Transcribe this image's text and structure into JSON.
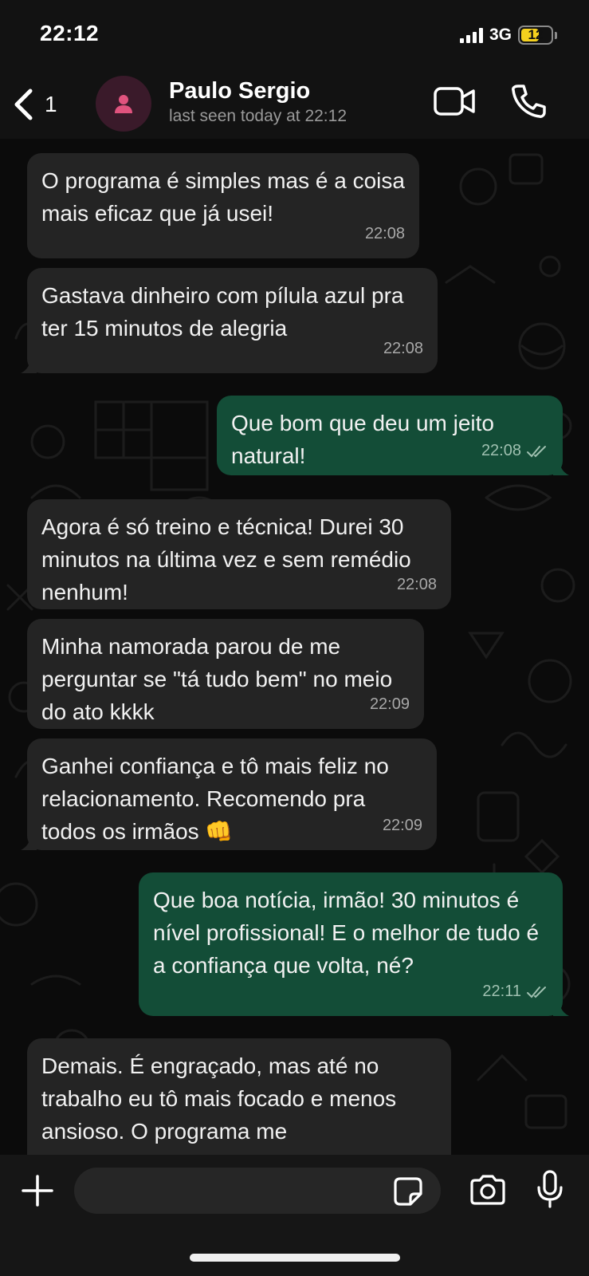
{
  "status_bar": {
    "time": "22:12",
    "network": "3G",
    "battery": "12",
    "battery_level": 0.12
  },
  "header": {
    "back_count": "1",
    "contact_name": "Paulo Sergio",
    "contact_status": "last seen today at 22:12"
  },
  "messages": [
    {
      "direction": "in",
      "text": "O programa é simples mas é a coisa mais eficaz que já usei!",
      "time": "22:08"
    },
    {
      "direction": "in",
      "text": "Gastava dinheiro com pílula azul pra ter 15 minutos de alegria",
      "time": "22:08"
    },
    {
      "direction": "out",
      "text": "Que bom que deu um jeito natural!",
      "time": "22:08",
      "status": "read"
    },
    {
      "direction": "in",
      "text": "Agora é só treino e técnica! Durei 30 minutos na última vez e sem remédio nenhum!",
      "time": "22:08"
    },
    {
      "direction": "in",
      "text": "Minha namorada parou de me perguntar se \"tá tudo bem\" no meio do ato kkkk",
      "time": "22:09"
    },
    {
      "direction": "in",
      "text": "Ganhei confiança e tô mais feliz no relacionamento. Recomendo pra todos os irmãos 👊",
      "time": "22:09"
    },
    {
      "direction": "out",
      "text": "Que boa notícia, irmão! 30 minutos é nível profissional! E o melhor de tudo é a confiança que volta, né?",
      "time": "22:11",
      "status": "read"
    },
    {
      "direction": "in",
      "text": "Demais. É engraçado, mas até no trabalho eu tô mais focado e menos ansioso. O programa me",
      "time": ""
    }
  ],
  "input": {
    "value": "",
    "placeholder": ""
  },
  "colors": {
    "incoming_bubble": "#242424",
    "outgoing_bubble": "#134d37",
    "background": "#0b0b0b"
  },
  "icons": [
    "chevron-left-icon",
    "person-icon",
    "video-camera-icon",
    "phone-icon",
    "plus-icon",
    "sticker-icon",
    "camera-icon",
    "microphone-icon",
    "double-check-icon"
  ]
}
